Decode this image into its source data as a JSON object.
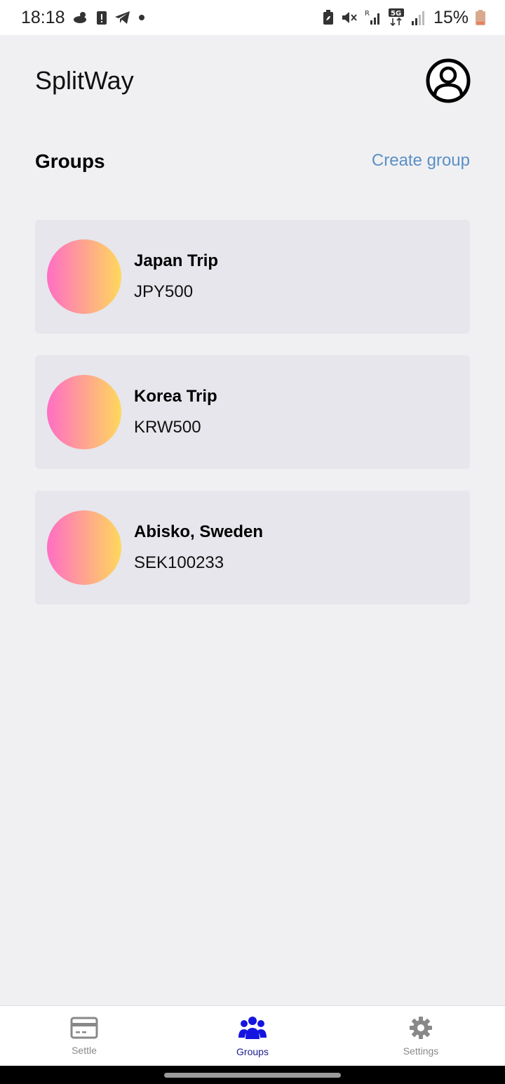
{
  "status_bar": {
    "time": "18:18",
    "battery": "15%",
    "icons_left": [
      "weather-icon",
      "alert-icon",
      "telegram-icon",
      "dot-icon"
    ],
    "icons_right": [
      "battery-saver-icon",
      "mute-icon",
      "signal-roaming-icon",
      "5g-icon",
      "signal-icon",
      "battery-icon"
    ],
    "network_5g_label": "5G",
    "roaming_label": "R"
  },
  "header": {
    "app_title": "SplitWay"
  },
  "groups_section": {
    "title": "Groups",
    "create_label": "Create group"
  },
  "groups": [
    {
      "name": "Japan Trip",
      "currency": "JPY500"
    },
    {
      "name": "Korea Trip",
      "currency": "KRW500"
    },
    {
      "name": "Abisko, Sweden",
      "currency": "SEK100233"
    }
  ],
  "bottom_nav": {
    "items": [
      {
        "label": "Settle",
        "icon": "card-icon",
        "active": false
      },
      {
        "label": "Groups",
        "icon": "people-icon",
        "active": true
      },
      {
        "label": "Settings",
        "icon": "gear-icon",
        "active": false
      }
    ]
  },
  "colors": {
    "accent_link": "#5b8fc7",
    "nav_active": "#1515e0",
    "nav_inactive": "#888888",
    "card_bg": "#e6e6ec",
    "avatar_gradient_start": "#ff6ec4",
    "avatar_gradient_end": "#ffd85c"
  }
}
